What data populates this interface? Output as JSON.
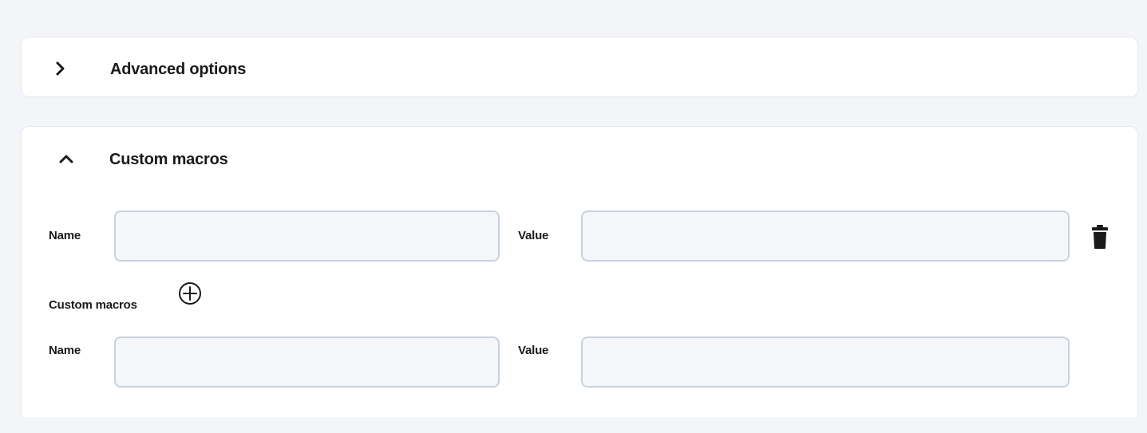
{
  "sections": {
    "advanced": {
      "title": "Advanced options",
      "expanded": false,
      "chevron_icon": "chevron-right-icon"
    },
    "custom_macros": {
      "title": "Custom macros",
      "expanded": true,
      "chevron_icon": "chevron-up-icon",
      "rows": [
        {
          "name_label": "Name",
          "name_value": "",
          "value_label": "Value",
          "value_value": "",
          "delete_icon": "trash-icon"
        },
        {
          "name_label": "Name",
          "name_value": "",
          "value_label": "Value",
          "value_value": ""
        }
      ],
      "add_label": "Custom macros",
      "add_icon": "plus-circle-icon"
    }
  },
  "colors": {
    "page_bg": "#f3f5f8",
    "panel_bg": "#ffffff",
    "input_bg": "#f4f6f9",
    "input_border": "#c9d2de",
    "text": "#1a1a1a"
  }
}
